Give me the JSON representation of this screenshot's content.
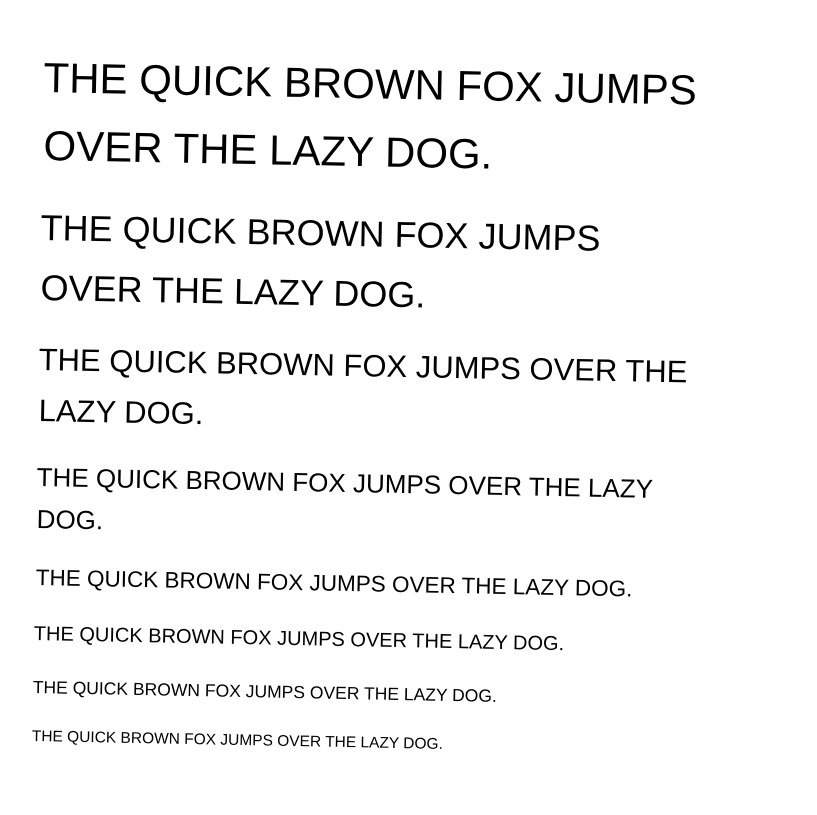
{
  "text": {
    "size_1": {
      "line_1": "THE QUICK BROWN FOX JUMPS",
      "line_2": "OVER THE LAZY DOG."
    },
    "size_2": {
      "line_1": "THE QUICK BROWN FOX JUMPS",
      "line_2": "OVER THE LAZY DOG."
    },
    "size_3": {
      "line_1": "THE QUICK BROWN FOX JUMPS OVER THE",
      "line_2": "LAZY DOG."
    },
    "size_4": {
      "line_1": "THE QUICK BROWN FOX JUMPS OVER THE LAZY",
      "line_2": "DOG."
    },
    "size_5": {
      "line_1": "THE QUICK BROWN FOX JUMPS OVER THE LAZY DOG."
    },
    "size_6": {
      "line_1": "THE QUICK BROWN FOX JUMPS OVER THE LAZY DOG."
    },
    "size_7": {
      "line_1": "THE QUICK BROWN FOX JUMPS OVER THE LAZY DOG."
    },
    "size_8": {
      "line_1": "THE QUICK BROWN FOX JUMPS OVER THE LAZY DOG."
    }
  },
  "colors": {
    "background": "#ffffff",
    "text": "#000000"
  }
}
